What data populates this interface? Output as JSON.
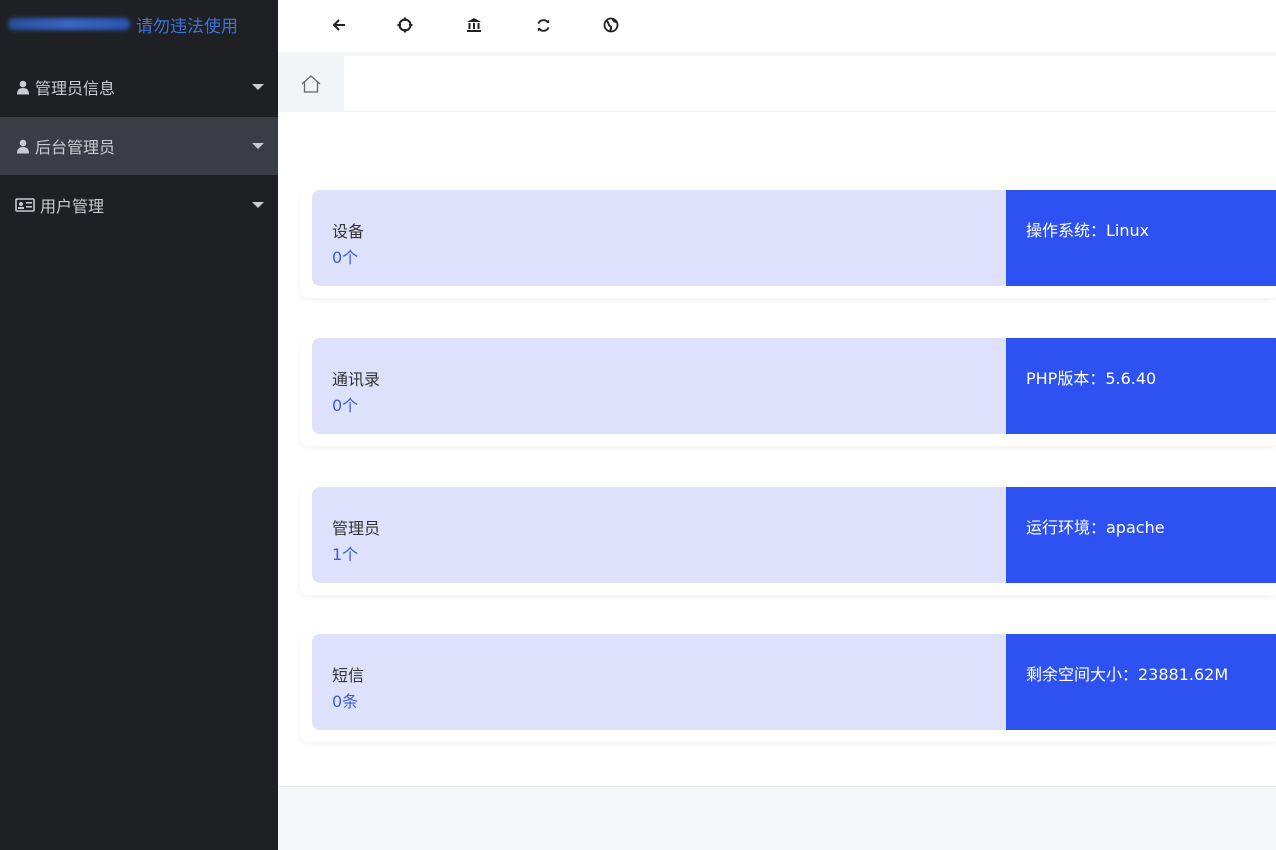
{
  "brand": {
    "blurred_name_obscured": true,
    "text": "请勿违法使用",
    "accent": "#3f71d8"
  },
  "sidebar": {
    "items": [
      {
        "label": "管理员信息",
        "icon": "user-icon",
        "active": false
      },
      {
        "label": "后台管理员",
        "icon": "user-icon",
        "active": true
      },
      {
        "label": "用户管理",
        "icon": "id-card-icon",
        "active": false
      }
    ]
  },
  "toolbar": {
    "icons": [
      "arrow-left-icon",
      "fullscreen-icon",
      "bank-icon",
      "refresh-icon",
      "globe-icon"
    ]
  },
  "tabs": {
    "home_icon": "home-icon"
  },
  "stats": [
    {
      "title": "设备",
      "count": "0个",
      "info": "操作系统：Linux"
    },
    {
      "title": "通讯录",
      "count": "0个",
      "info": "PHP版本：5.6.40"
    },
    {
      "title": "管理员",
      "count": "1个",
      "info": "运行环境：apache"
    },
    {
      "title": "短信",
      "count": "0条",
      "info": "剩余空间大小：23881.62M"
    }
  ],
  "colors": {
    "sidebar_bg": "#1e2024",
    "card_left_bg": "#dde1fb",
    "card_right_bg": "#2e52f2",
    "count_text": "#3a5bd9"
  }
}
